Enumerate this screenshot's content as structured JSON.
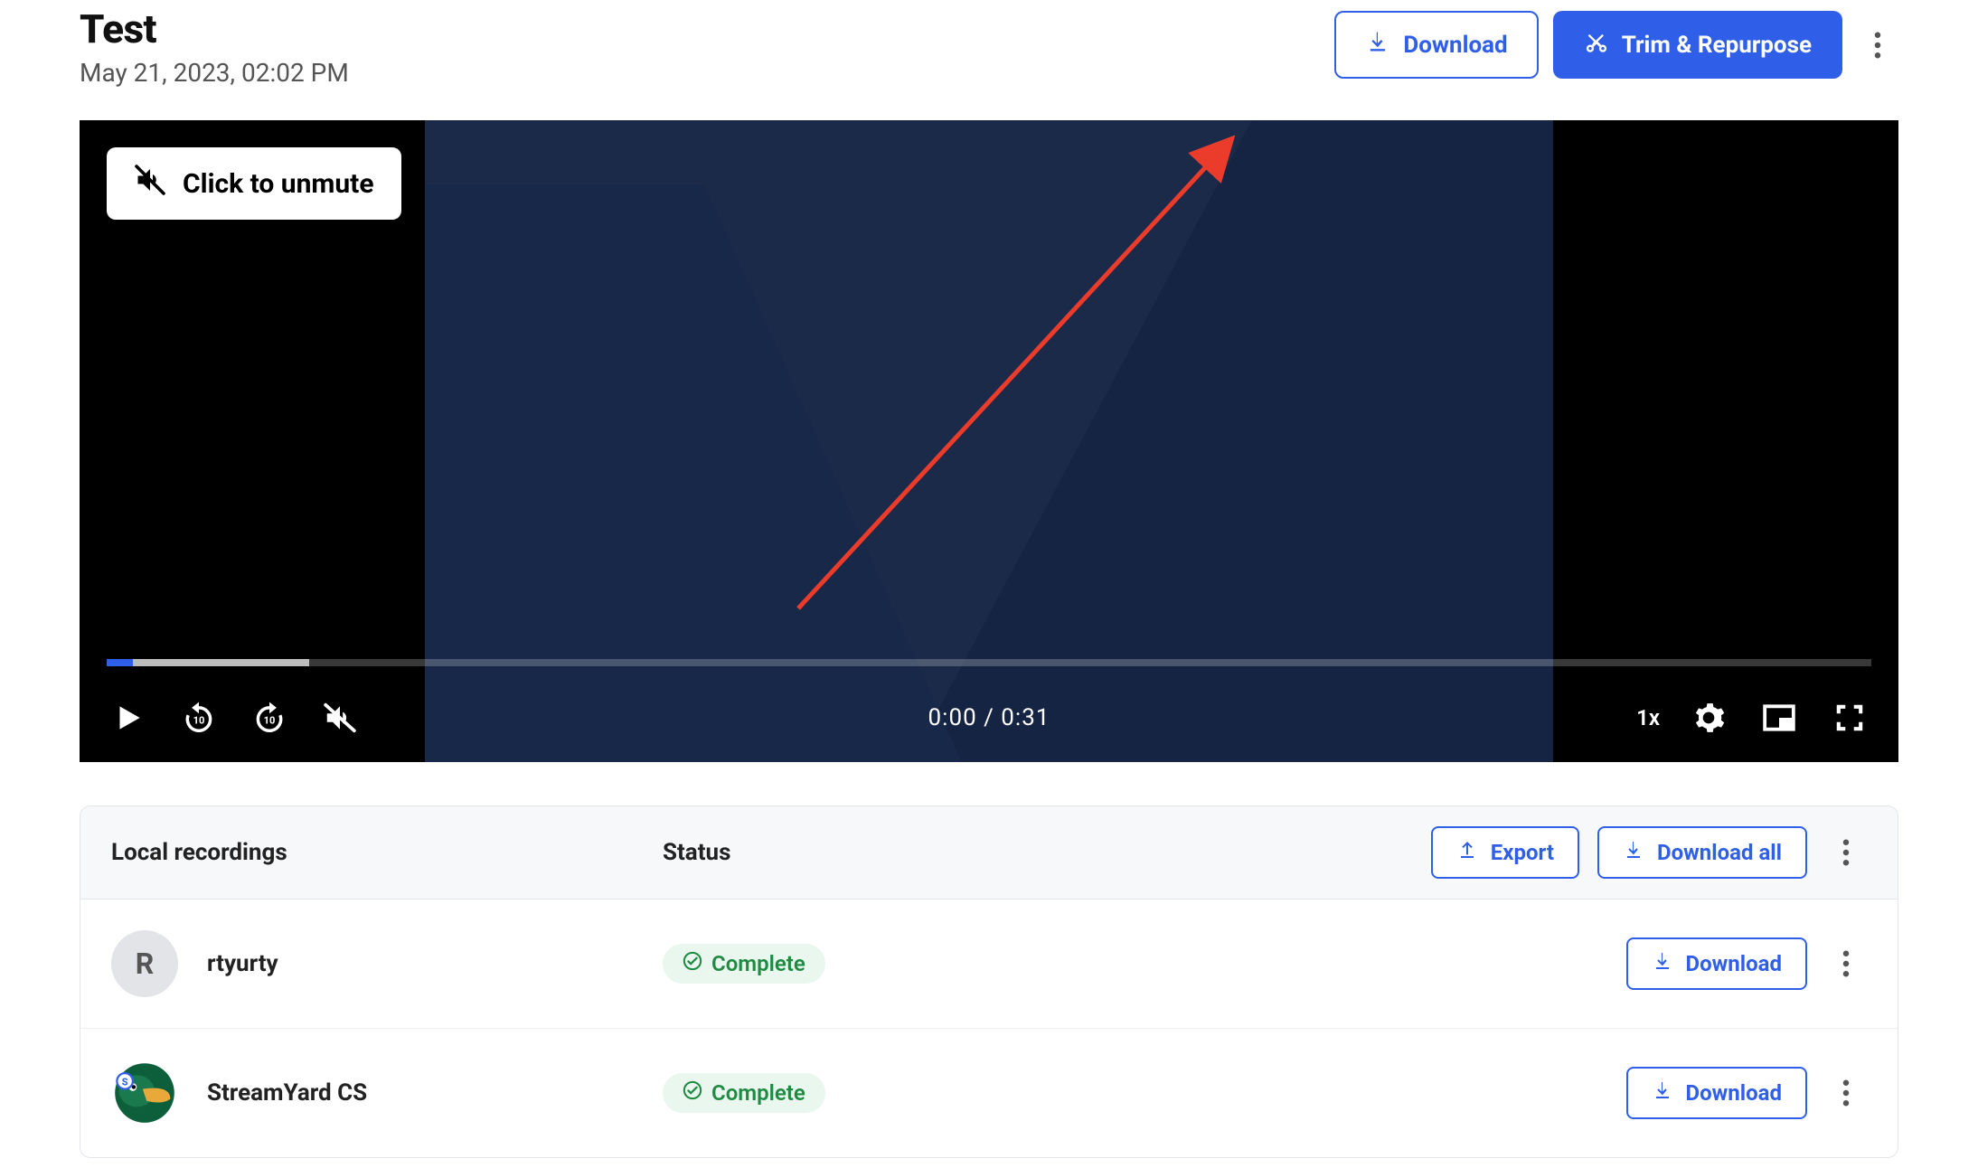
{
  "header": {
    "title": "Test",
    "date": "May 21, 2023, 02:02 PM",
    "download_label": "Download",
    "trim_label": "Trim & Repurpose"
  },
  "player": {
    "unmute_label": "Click to unmute",
    "time_display": "0:00 / 0:31",
    "speed_label": "1x"
  },
  "recordings": {
    "title": "Local recordings",
    "status_label": "Status",
    "export_label": "Export",
    "download_all_label": "Download all",
    "rows": [
      {
        "avatar_letter": "R",
        "avatar_type": "letter",
        "name": "rtyurty",
        "status": "Complete",
        "action": "Download"
      },
      {
        "avatar_letter": "",
        "avatar_type": "image",
        "name": "StreamYard CS",
        "status": "Complete",
        "action": "Download"
      }
    ]
  }
}
